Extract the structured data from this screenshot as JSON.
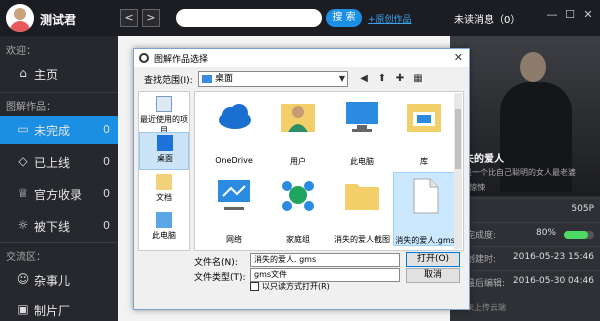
{
  "colors": {
    "accent": "#1a8fe3",
    "progress": "#4cd964"
  },
  "header": {
    "username": "测试君",
    "back_label": "<",
    "forward_label": ">",
    "search_placeholder": "",
    "search_button": "搜 索",
    "publish_link": "+原创作品",
    "unread": "未读消息（0）",
    "min_label": "—",
    "max_label": "☐",
    "close_label": "✕"
  },
  "sidebar": {
    "welcome": "欢迎：",
    "home": "主页",
    "library_title": "图解作品：",
    "items": [
      {
        "label": "未完成",
        "count": "0",
        "icon": "document-icon"
      },
      {
        "label": "已上线",
        "count": "0",
        "icon": "tag-icon"
      },
      {
        "label": "官方收录",
        "count": "0",
        "icon": "trophy-icon"
      },
      {
        "label": "被下线",
        "count": "0",
        "icon": "bulb-icon"
      }
    ],
    "community_title": "交流区：",
    "community": [
      {
        "label": "杂事儿",
        "icon": "chat-icon"
      },
      {
        "label": "制片厂",
        "icon": "film-icon"
      }
    ]
  },
  "right_panel": {
    "title": "失的爱人",
    "desc": "是一个比自己聪明的女人最老婆",
    "author": "| 惊悚",
    "rows": [
      {
        "key": "",
        "value": "505P"
      },
      {
        "key": "完成度:",
        "value": "80%"
      },
      {
        "key": "创建时:",
        "value": "2016-05-23 15:46"
      },
      {
        "key": "最后编辑:",
        "value": "2016-05-30 04:46"
      }
    ],
    "progress": 0.8,
    "footer": "未上传云端"
  },
  "dialog": {
    "title": "图解作品选择",
    "close": "✕",
    "look_in_label": "查找范围(I):",
    "look_in_value": "桌面",
    "places": [
      {
        "label": "最近使用的项目",
        "icon": "recent-icon"
      },
      {
        "label": "桌面",
        "icon": "desktop-icon"
      },
      {
        "label": "文档",
        "icon": "documents-icon"
      },
      {
        "label": "此电脑",
        "icon": "computer-icon"
      }
    ],
    "files": [
      {
        "label": "OneDrive",
        "icon": "onedrive-icon"
      },
      {
        "label": "用户",
        "icon": "user-folder-icon"
      },
      {
        "label": "此电脑",
        "icon": "this-pc-icon"
      },
      {
        "label": "库",
        "icon": "library-icon"
      },
      {
        "label": "网络",
        "icon": "network-icon"
      },
      {
        "label": "家庭组",
        "icon": "homegroup-icon"
      },
      {
        "label": "消失的爱人截图",
        "icon": "folder-icon"
      },
      {
        "label": "消失的爱人.gms",
        "icon": "gms-file-icon"
      }
    ],
    "filename_label": "文件名(N):",
    "filename_value": "消失的爱人. gms",
    "filetype_label": "文件类型(T):",
    "filetype_value": "gms文件",
    "readonly_label": "以只读方式打开(R)",
    "open_button": "打开(O)",
    "cancel_button": "取消"
  }
}
